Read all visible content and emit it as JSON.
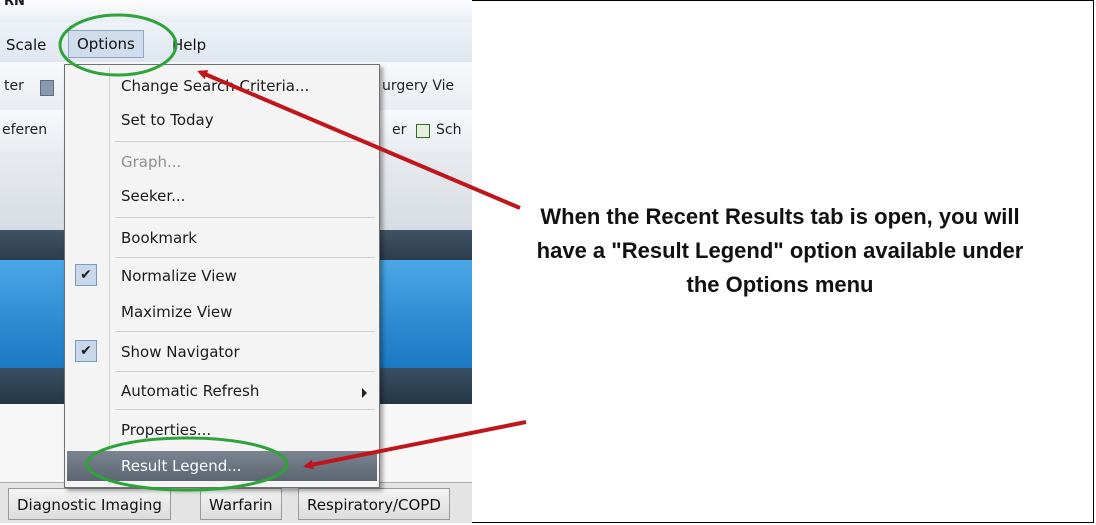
{
  "app": {
    "title_fragment": "RN"
  },
  "menubar": {
    "scale": "Scale",
    "options": "Options",
    "help": "Help"
  },
  "toolbar": {
    "row1_left": "ter",
    "row1_right": "urgery Vie",
    "row2_left": "eferen",
    "row2_right_a": "er",
    "row2_right_b": "Sch"
  },
  "options_menu": {
    "items": [
      {
        "label": "Change Search Criteria...",
        "enabled": true,
        "checked": false
      },
      {
        "label": "Set to Today",
        "enabled": true,
        "checked": false
      },
      {
        "label": "Graph...",
        "enabled": false,
        "checked": false
      },
      {
        "label": "Seeker...",
        "enabled": true,
        "checked": false
      },
      {
        "label": "Bookmark",
        "enabled": true,
        "checked": false
      },
      {
        "label": "Normalize View",
        "enabled": true,
        "checked": true
      },
      {
        "label": "Maximize View",
        "enabled": true,
        "checked": false
      },
      {
        "label": "Show Navigator",
        "enabled": true,
        "checked": true
      },
      {
        "label": "Automatic Refresh",
        "enabled": true,
        "checked": false,
        "submenu": true
      },
      {
        "label": "Properties...",
        "enabled": true,
        "checked": false
      },
      {
        "label": "Result Legend...",
        "enabled": true,
        "checked": false,
        "highlighted": true
      }
    ],
    "check_glyph": "✔"
  },
  "tabs": [
    "Diagnostic Imaging",
    "Warfarin",
    "Respiratory/COPD"
  ],
  "annotation": {
    "text": "When the Recent Results tab is open, you will have a \"Result Legend\" option available under the Options menu",
    "arrow_color": "#c0161b",
    "ellipse_color": "#2fa33a"
  },
  "colors": {
    "menu_highlight": "#5c6671",
    "check_bg": "#c8d8ea",
    "window_blue": "#1b78c2"
  }
}
